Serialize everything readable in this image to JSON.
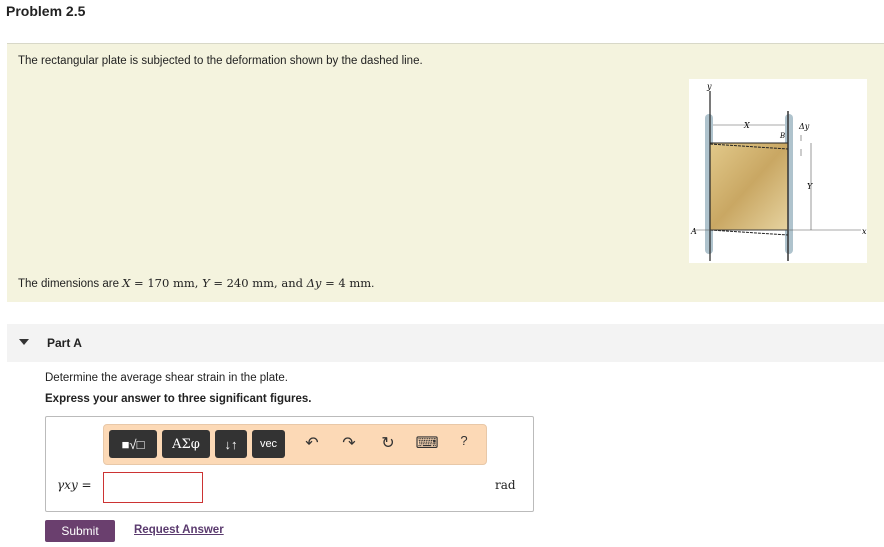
{
  "title": "Problem 2.5",
  "statement": "The rectangular plate is subjected to the deformation shown by the dashed line.",
  "dims": {
    "prefix": "The dimensions are ",
    "X": "X",
    "eq1": " = 170 mm, ",
    "Y": "Y",
    "eq2": " = 240 mm, and ",
    "dy": "Δy",
    "eq3": " = 4 mm",
    "suffix": "."
  },
  "figure": {
    "y": "y",
    "X": "X",
    "dy": "Δy",
    "B": "B",
    "Y": "Y",
    "A": "A",
    "x": "x"
  },
  "part": {
    "label": "Part A",
    "question": "Determine the average shear strain in the plate.",
    "instruction": "Express your answer to three significant figures."
  },
  "toolbar": {
    "templates": "■√□",
    "greek": "ΑΣφ",
    "arrows": "↓↑",
    "vec": "vec",
    "undo": "↶",
    "redo": "↷",
    "reset": "↻",
    "keyboard": "⌨",
    "help": "?"
  },
  "answer": {
    "symbol": "γxy =",
    "value": "",
    "unit": "rad"
  },
  "buttons": {
    "submit": "Submit",
    "request": "Request Answer"
  }
}
